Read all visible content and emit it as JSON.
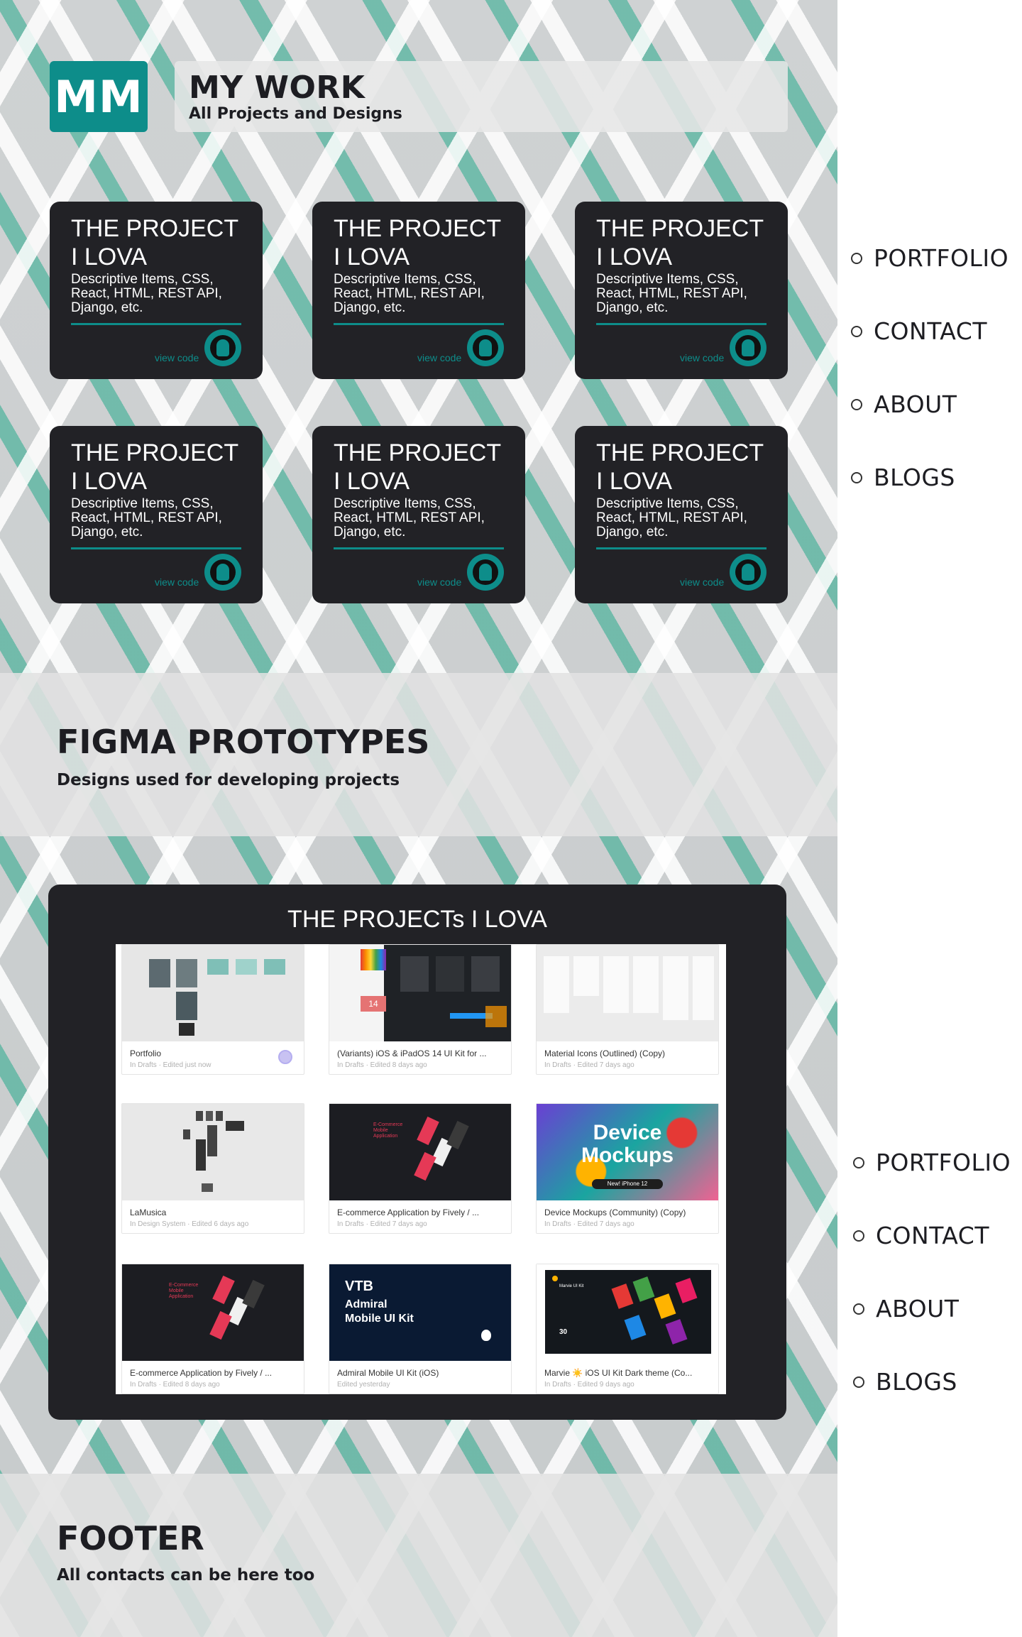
{
  "header": {
    "logo": "MM",
    "title": "MY WORK",
    "subtitle": "All Projects and Designs"
  },
  "project_cards": [
    {
      "title": "THE PROJECT I LOVA",
      "description": "Descriptive Items, CSS, React, HTML, REST API, Django, etc.",
      "link": "view code"
    },
    {
      "title": "THE PROJECT I LOVA",
      "description": "Descriptive Items, CSS, React, HTML, REST API, Django, etc.",
      "link": "view code"
    },
    {
      "title": "THE PROJECT I LOVA",
      "description": "Descriptive Items, CSS, React, HTML, REST API, Django, etc.",
      "link": "view code"
    },
    {
      "title": "THE PROJECT I LOVA",
      "description": "Descriptive Items, CSS, React, HTML, REST API, Django, etc.",
      "link": "view code"
    },
    {
      "title": "THE PROJECT I LOVA",
      "description": "Descriptive Items, CSS, React, HTML, REST API, Django, etc.",
      "link": "view code"
    },
    {
      "title": "THE PROJECT I LOVA",
      "description": "Descriptive Items, CSS, React, HTML, REST API, Django, etc.",
      "link": "view code"
    }
  ],
  "figma_section": {
    "title": "FIGMA PROTOTYPES",
    "subtitle": "Designs used for developing projects"
  },
  "figma_panel": {
    "title": "THE PROJECTs I LOVA",
    "files": [
      {
        "name": "Portfolio",
        "meta": "In Drafts · Edited just now"
      },
      {
        "name": "(Variants) iOS & iPadOS 14 UI Kit for ...",
        "meta": "In Drafts · Edited 8 days ago"
      },
      {
        "name": "Material Icons (Outlined) (Copy)",
        "meta": "In Drafts · Edited 7 days ago"
      },
      {
        "name": "LaMusica",
        "meta": "In Design System · Edited 6 days ago"
      },
      {
        "name": "E-commerce Application by Fively / ...",
        "meta": "In Drafts · Edited 7 days ago"
      },
      {
        "name": "Device Mockups (Community) (Copy)",
        "meta": "In Drafts · Edited 7 days ago"
      },
      {
        "name": "E-commerce Application by Fively / ...",
        "meta": "In Drafts · Edited 8 days ago"
      },
      {
        "name": "Admiral Mobile UI Kit (iOS)",
        "meta": "Edited yesterday"
      },
      {
        "name": "Marvie ☀️ iOS UI Kit Dark theme (Co...",
        "meta": "In Drafts · Edited 9 days ago"
      }
    ],
    "thumb_text": {
      "ios_number": "14",
      "ecommerce_label": "E-Commerce Mobile Application",
      "device_title_1": "Device",
      "device_title_2": "Mockups",
      "device_badge": "New! iPhone 12",
      "vtb_title": "VTB",
      "vtb_sub_1": "Admiral",
      "vtb_sub_2": "Mobile UI Kit",
      "marvie_header": "Marvie UI Kit",
      "marvie_count": "30"
    }
  },
  "footer": {
    "title": "FOOTER",
    "subtitle": "All contacts can be here too"
  },
  "side_nav": [
    "PORTFOLIO",
    "CONTACT",
    "ABOUT",
    "BLOGS"
  ],
  "colors": {
    "accent": "#0d8d8a",
    "card_bg": "#222226",
    "text_dark": "#1d1d22"
  }
}
